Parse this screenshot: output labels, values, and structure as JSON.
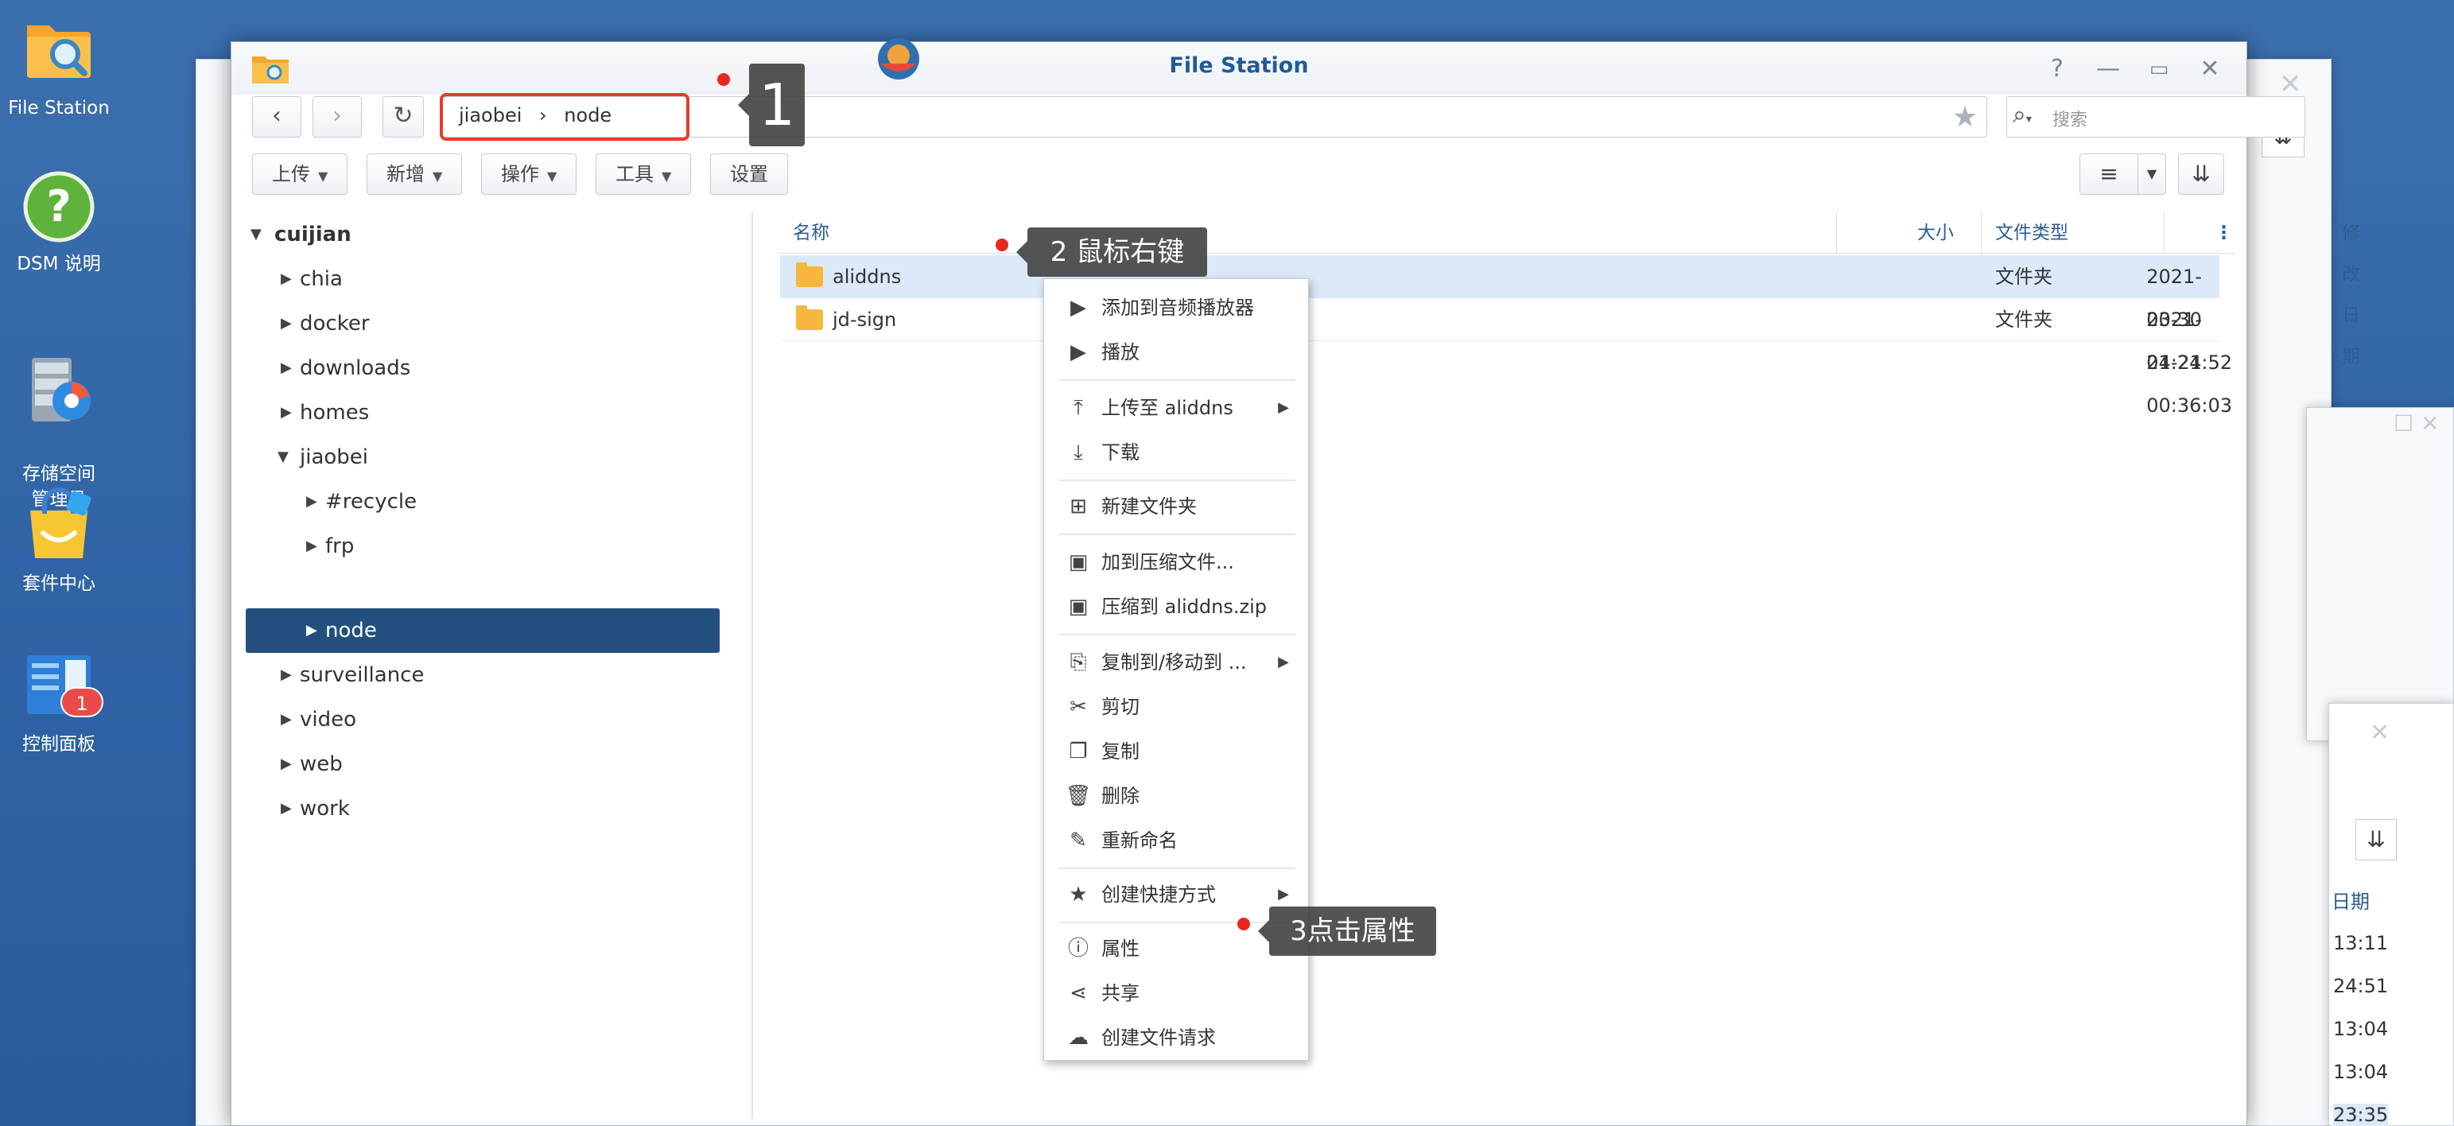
{
  "desktop": {
    "icons": [
      {
        "label": "File Station"
      },
      {
        "label": "DSM 说明"
      },
      {
        "label": "存储空间\n管理员"
      },
      {
        "label": "套件中心"
      },
      {
        "label": "控制面板",
        "badge": "1"
      }
    ]
  },
  "window": {
    "title": "File Station",
    "path": {
      "segment1": "jiaobei",
      "separator": "›",
      "segment2": "node"
    },
    "search_placeholder": "搜索",
    "toolbar": {
      "upload": "上传",
      "new": "新增",
      "action": "操作",
      "tools": "工具",
      "settings": "设置"
    }
  },
  "tree": {
    "root": "cuijian",
    "items": [
      "chia",
      "docker",
      "downloads",
      "homes",
      "jiaobei",
      "#recycle",
      "frp",
      "node",
      "surveillance",
      "video",
      "web",
      "work"
    ]
  },
  "list": {
    "columns": {
      "name": "名称",
      "size": "大小",
      "type": "文件类型",
      "modified": "修改日期"
    },
    "rows": [
      {
        "name": "aliddns",
        "type": "文件夹",
        "modified": "2021-03-30 21:24:52"
      },
      {
        "name": "jd-sign",
        "type": "文件夹",
        "modified": "2021-04-21 00:36:03"
      }
    ]
  },
  "context_menu": {
    "items": [
      "添加到音频播放器",
      "播放",
      "上传至 aliddns",
      "下载",
      "新建文件夹",
      "加到压缩文件...",
      "压缩到 aliddns.zip",
      "复制到/移动到 ...",
      "剪切",
      "复制",
      "删除",
      "重新命名",
      "创建快捷方式",
      "属性",
      "共享",
      "创建文件请求"
    ]
  },
  "annotations": {
    "step1": "1",
    "step2": "2 鼠标右键",
    "step3": "3点击属性"
  },
  "background_window": {
    "times": [
      "13:11",
      "24:51",
      "13:04",
      "13:04",
      "23:35"
    ],
    "col_label": "日期"
  },
  "colors": {
    "accent": "#234f7f",
    "title": "#1f5b99",
    "highlight": "#e83a2c",
    "folder": "#f6b73c",
    "desktop": "#3068a8"
  }
}
